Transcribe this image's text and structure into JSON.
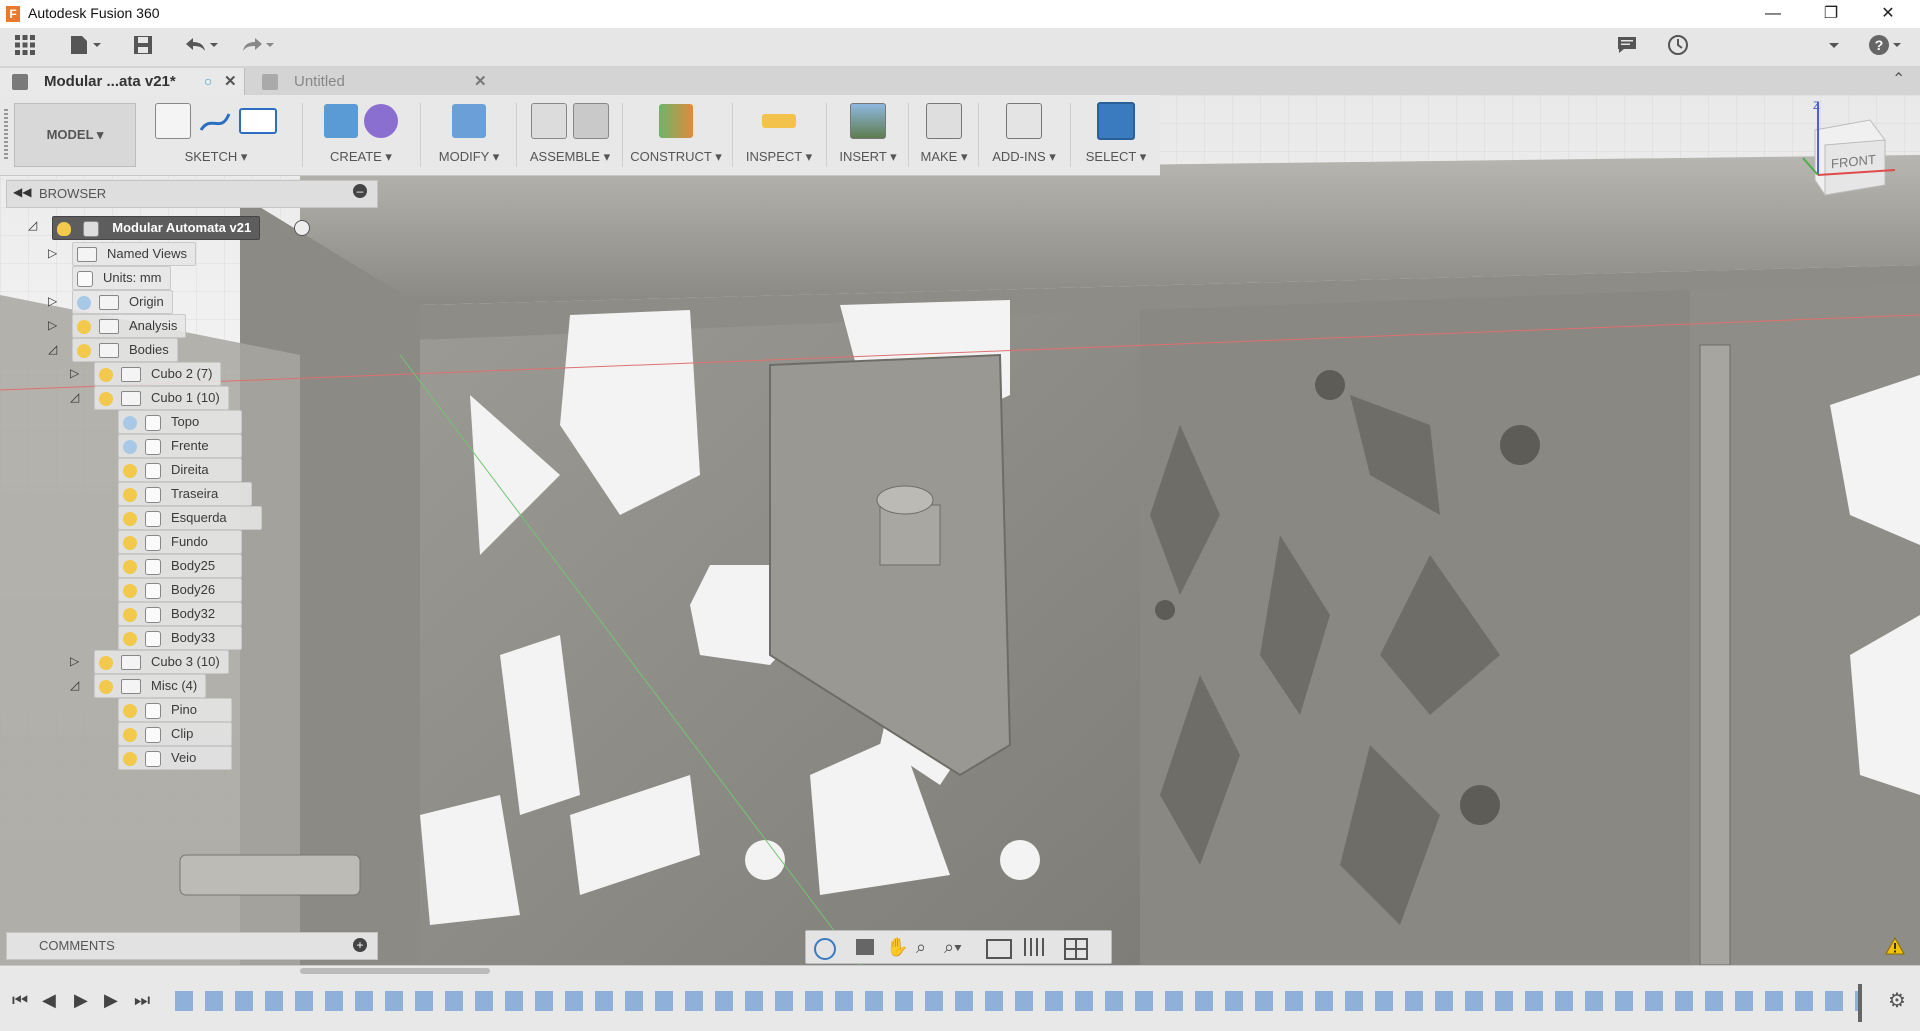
{
  "window": {
    "title": "Autodesk Fusion 360",
    "minimize_icon": "minimize-icon",
    "maximize_icon": "restore-icon",
    "close_icon": "close-icon"
  },
  "tabs": [
    {
      "label": "Modular ...ata v21*",
      "active": true
    },
    {
      "label": "Untitled",
      "active": false
    }
  ],
  "ribbon": {
    "workspace": "MODEL",
    "groups": [
      {
        "label": "SKETCH"
      },
      {
        "label": "CREATE"
      },
      {
        "label": "MODIFY"
      },
      {
        "label": "ASSEMBLE"
      },
      {
        "label": "CONSTRUCT"
      },
      {
        "label": "INSPECT"
      },
      {
        "label": "INSERT"
      },
      {
        "label": "MAKE"
      },
      {
        "label": "ADD-INS"
      },
      {
        "label": "SELECT"
      }
    ]
  },
  "browser": {
    "title": "BROWSER",
    "root": "Modular Automata v21",
    "items": [
      {
        "label": "Named Views"
      },
      {
        "label": "Units: mm"
      },
      {
        "label": "Origin"
      },
      {
        "label": "Analysis"
      },
      {
        "label": "Bodies"
      },
      {
        "label": "Cubo 2 (7)"
      },
      {
        "label": "Cubo 1 (10)"
      },
      {
        "label": "Topo"
      },
      {
        "label": "Frente"
      },
      {
        "label": "Direita"
      },
      {
        "label": "Traseira"
      },
      {
        "label": "Esquerda"
      },
      {
        "label": "Fundo"
      },
      {
        "label": "Body25"
      },
      {
        "label": "Body26"
      },
      {
        "label": "Body32"
      },
      {
        "label": "Body33"
      },
      {
        "label": "Cubo 3 (10)"
      },
      {
        "label": "Misc (4)"
      },
      {
        "label": "Pino"
      },
      {
        "label": "Clip"
      },
      {
        "label": "Veio"
      }
    ]
  },
  "comments": {
    "title": "COMMENTS"
  },
  "viewcube": {
    "face": "FRONT",
    "axis_z": "Z"
  },
  "colors": {
    "accent": "#0f7fbf",
    "bulb": "#f2c94c",
    "bulb_off": "#a8c8e8",
    "select_active": "#3a7bbf"
  }
}
